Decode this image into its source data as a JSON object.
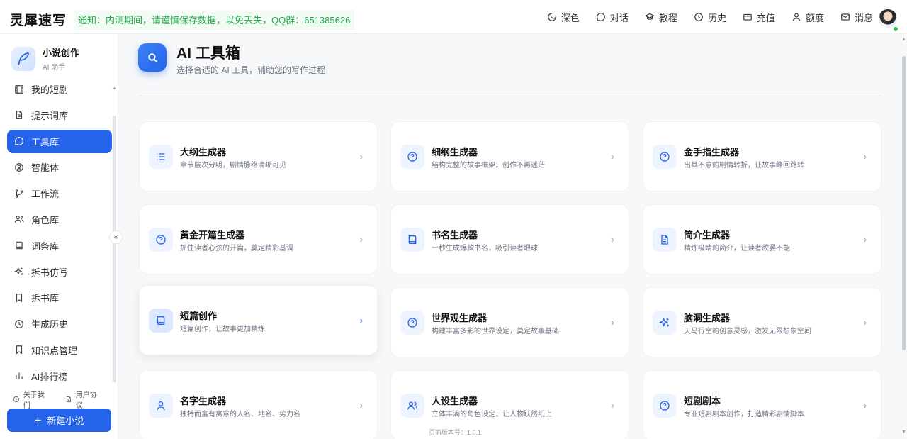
{
  "topbar": {
    "brand": "灵犀速写",
    "notice": "通知：内测期间，请谨慎保存数据，以免丢失，QQ群：651385626",
    "nav": [
      {
        "label": "深色",
        "icon": "moon-icon"
      },
      {
        "label": "对话",
        "icon": "chat-icon"
      },
      {
        "label": "教程",
        "icon": "graduation-cap-icon"
      },
      {
        "label": "历史",
        "icon": "clock-icon"
      },
      {
        "label": "充值",
        "icon": "card-icon"
      },
      {
        "label": "额度",
        "icon": "user-icon"
      },
      {
        "label": "消息",
        "icon": "mail-icon"
      }
    ]
  },
  "sidebar": {
    "title": "小说创作",
    "subtitle": "AI 助手",
    "items": [
      {
        "label": "我的短剧",
        "icon": "film-icon"
      },
      {
        "label": "提示词库",
        "icon": "document-icon"
      },
      {
        "label": "工具库",
        "icon": "chat-icon",
        "active": true
      },
      {
        "label": "智能体",
        "icon": "user-circle-icon"
      },
      {
        "label": "工作流",
        "icon": "git-branch-icon"
      },
      {
        "label": "角色库",
        "icon": "users-icon"
      },
      {
        "label": "词条库",
        "icon": "book-icon"
      },
      {
        "label": "拆书仿写",
        "icon": "sparkles-icon"
      },
      {
        "label": "拆书库",
        "icon": "bookmark-icon"
      },
      {
        "label": "生成历史",
        "icon": "clock-icon"
      },
      {
        "label": "知识点管理",
        "icon": "bookmark-icon"
      },
      {
        "label": "AI排行榜",
        "icon": "chart-icon"
      }
    ],
    "footer_about": "关于我们",
    "footer_terms": "用户协议",
    "new_button": "新建小说"
  },
  "main": {
    "title": "AI 工具箱",
    "subtitle": "选择合适的 AI 工具，辅助您的写作过程",
    "tools": [
      {
        "title": "大纲生成器",
        "desc": "章节层次分明，剧情脉络清晰可见",
        "icon": "list-icon"
      },
      {
        "title": "细纲生成器",
        "desc": "结构完整的故事框架，创作不再迷茫",
        "icon": "help-circle-icon"
      },
      {
        "title": "金手指生成器",
        "desc": "出其不意的剧情转折，让故事峰回路转",
        "icon": "help-circle-icon"
      },
      {
        "title": "黄金开篇生成器",
        "desc": "抓住读者心弦的开篇，奠定精彩基调",
        "icon": "help-circle-icon"
      },
      {
        "title": "书名生成器",
        "desc": "一秒生成爆款书名，吸引读者眼球",
        "icon": "book-icon"
      },
      {
        "title": "简介生成器",
        "desc": "精炼吸睛的简介，让读者欲罢不能",
        "icon": "file-text-icon"
      },
      {
        "title": "短篇创作",
        "desc": "短篇创作，让故事更加精炼",
        "icon": "book-icon"
      },
      {
        "title": "世界观生成器",
        "desc": "构建丰富多彩的世界设定，奠定故事基础",
        "icon": "help-circle-icon"
      },
      {
        "title": "脑洞生成器",
        "desc": "天马行空的创意灵感，激发无限想象空间",
        "icon": "sparkles-icon"
      },
      {
        "title": "名字生成器",
        "desc": "独特而富有寓意的人名、地名、势力名",
        "icon": "user-icon"
      },
      {
        "title": "人设生成器",
        "desc": "立体丰满的角色设定，让人物跃然纸上",
        "icon": "users-icon"
      },
      {
        "title": "短剧剧本",
        "desc": "专业短剧剧本创作，打造精彩剧情脚本",
        "icon": "help-circle-icon"
      }
    ],
    "version": "页面版本号：1.0.1"
  },
  "colors": {
    "accent": "#2563eb",
    "notice": "#22a84a"
  }
}
